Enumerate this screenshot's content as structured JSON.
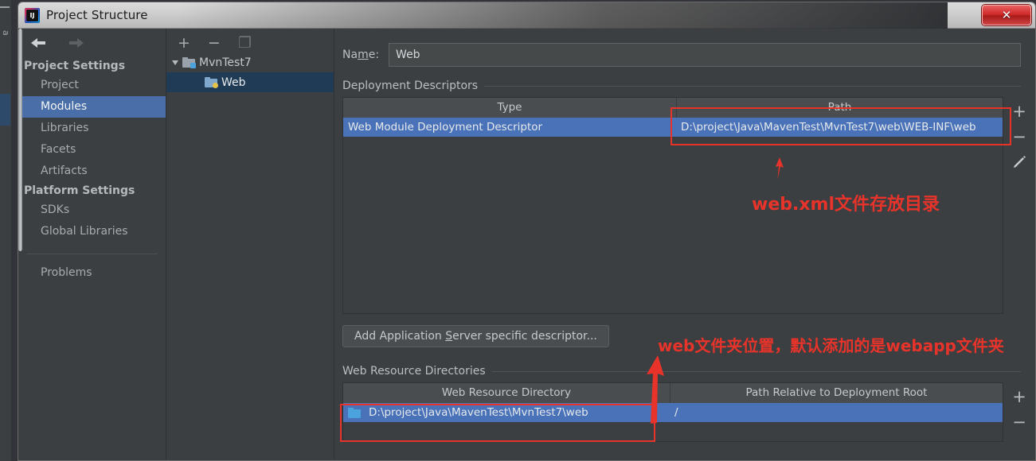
{
  "window": {
    "title": "Project Structure",
    "app_icon": "intellij-idea-icon",
    "close_label": "✕"
  },
  "sidebar": {
    "back_icon": "arrow-left-icon",
    "forward_icon": "arrow-right-icon",
    "groups": [
      {
        "label": "Project Settings",
        "items": [
          {
            "label": "Project",
            "selected": false
          },
          {
            "label": "Modules",
            "selected": true
          },
          {
            "label": "Libraries",
            "selected": false
          },
          {
            "label": "Facets",
            "selected": false
          },
          {
            "label": "Artifacts",
            "selected": false
          }
        ]
      },
      {
        "label": "Platform Settings",
        "items": [
          {
            "label": "SDKs",
            "selected": false
          },
          {
            "label": "Global Libraries",
            "selected": false
          }
        ]
      }
    ],
    "extra_items": [
      {
        "label": "Problems",
        "selected": false
      }
    ]
  },
  "tree": {
    "toolbar": [
      {
        "icon": "plus-icon",
        "label": "+",
        "enabled": true
      },
      {
        "icon": "minus-icon",
        "label": "−",
        "enabled": true
      },
      {
        "icon": "copy-icon",
        "label": "❐",
        "enabled": false
      }
    ],
    "nodes": [
      {
        "label": "MvnTest7",
        "level": 0,
        "expanded": true,
        "selected": false,
        "icon": "module-folder-icon"
      },
      {
        "label": "Web",
        "level": 1,
        "expanded": false,
        "selected": true,
        "icon": "web-facet-icon"
      }
    ]
  },
  "main": {
    "name_label": "Name:",
    "name_mnemonic": "m",
    "name_value": "Web",
    "deployment_descriptors": {
      "section_label": "Deployment Descriptors",
      "columns": [
        "Type",
        "Path"
      ],
      "rows": [
        {
          "type": "Web Module Deployment Descriptor",
          "path": "D:\\project\\Java\\MavenTest\\MvnTest7\\web\\WEB-INF\\web",
          "selected": true
        }
      ],
      "buttons": [
        {
          "icon": "plus-icon",
          "label": "+"
        },
        {
          "icon": "minus-icon",
          "label": "−"
        },
        {
          "icon": "pencil-icon",
          "label": "✎"
        }
      ]
    },
    "add_descriptor_button": {
      "prefix": "Add Application ",
      "mnemonic": "S",
      "suffix": "erver specific descriptor..."
    },
    "web_resource_directories": {
      "section_label": "Web Resource Directories",
      "columns": [
        "Web Resource Directory",
        "Path Relative to Deployment Root"
      ],
      "rows": [
        {
          "directory": "D:\\project\\Java\\MavenTest\\MvnTest7\\web",
          "relative_path": "/",
          "selected": true,
          "icon": "folder-icon"
        }
      ],
      "buttons": [
        {
          "icon": "plus-icon",
          "label": "+"
        },
        {
          "icon": "minus-icon",
          "label": "−"
        }
      ]
    }
  },
  "annotations": {
    "accent_color": "#e8332a",
    "notes": [
      {
        "id": "webxml-note",
        "text": "web.xml文件存放目录"
      },
      {
        "id": "webdir-note",
        "text": "web文件夹位置，默认添加的是webapp文件夹"
      }
    ]
  },
  "backdrop": {
    "vertical_text": "a"
  }
}
